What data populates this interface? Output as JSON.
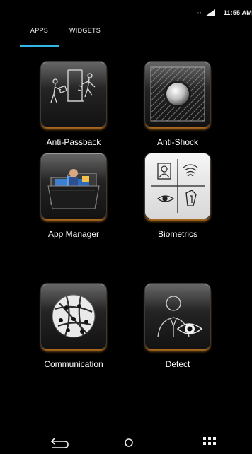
{
  "status_bar": {
    "data_indicator": "↔",
    "time": "11:55 AM"
  },
  "tabs": [
    {
      "label": "APPS",
      "active": true
    },
    {
      "label": "WIDGETS",
      "active": false
    }
  ],
  "accent_color": "#33b5e5",
  "apps": [
    {
      "label": "Anti-Passback",
      "icon": "anti-passback-icon"
    },
    {
      "label": "Anti-Shock",
      "icon": "anti-shock-icon"
    },
    {
      "label": "App Manager",
      "icon": "app-manager-icon"
    },
    {
      "label": "Biometrics",
      "icon": "biometrics-icon"
    },
    {
      "label": "Communication",
      "icon": "communication-icon"
    },
    {
      "label": "Detect",
      "icon": "detect-icon"
    }
  ],
  "nav_bar": {
    "back": "back-icon",
    "home": "home-icon",
    "recents": "app-drawer-icon"
  }
}
